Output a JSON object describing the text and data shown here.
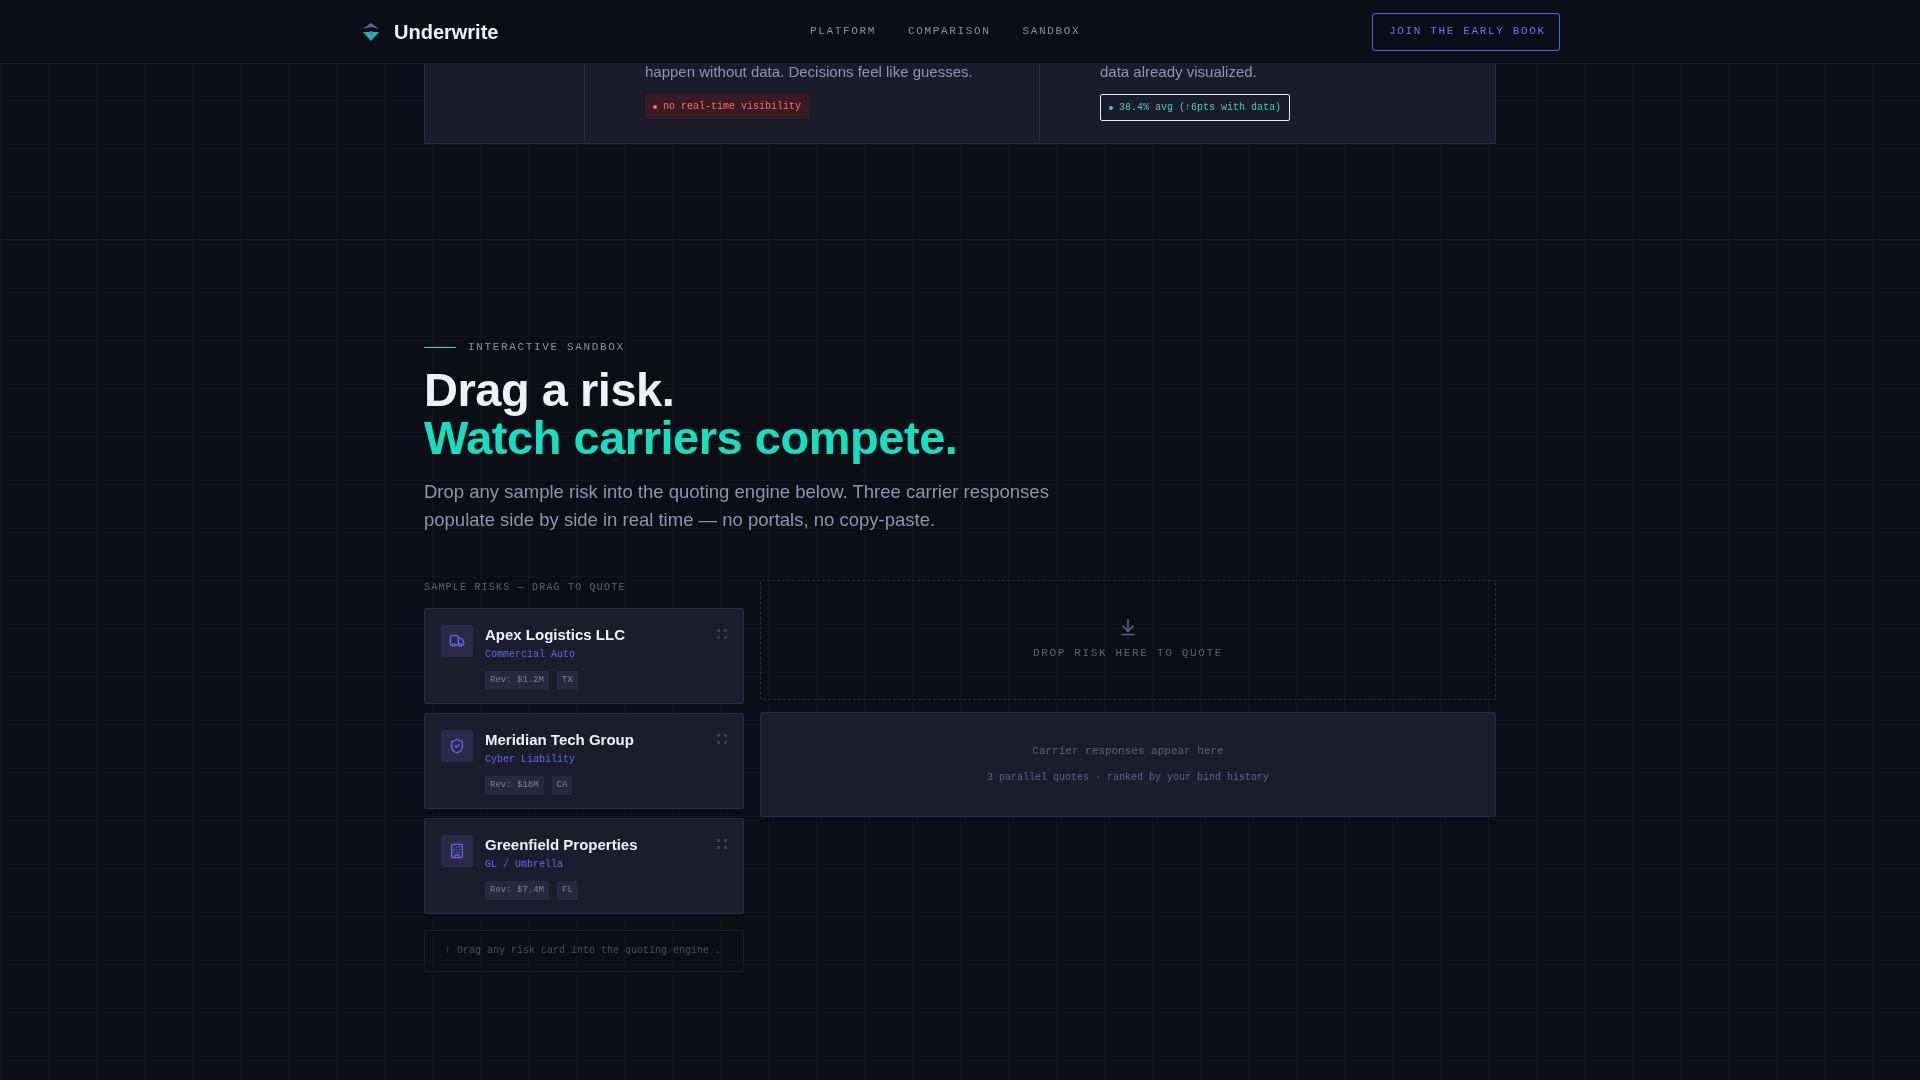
{
  "header": {
    "brand": "Underwrite",
    "nav": [
      {
        "label": "PLATFORM"
      },
      {
        "label": "COMPARISON"
      },
      {
        "label": "SANDBOX"
      }
    ],
    "cta": "JOIN THE EARLY BOOK"
  },
  "comparison": {
    "columns": [
      {
        "text": "happen without data. Decisions feel like guesses.",
        "badge": {
          "kind": "bad",
          "label": "no real-time visibility"
        }
      },
      {
        "text": "data already visualized.",
        "badge": {
          "kind": "good",
          "label": "38.4% avg (↑6pts with data)"
        }
      }
    ]
  },
  "sandbox": {
    "eyebrow": "INTERACTIVE SANDBOX",
    "title_line1": "Drag a risk.",
    "title_line2": "Watch carriers compete.",
    "description": "Drop any sample risk into the quoting engine below. Three carrier responses populate side by side in real time — no portals, no copy-paste.",
    "risks_label": "SAMPLE RISKS — DRAG TO QUOTE",
    "risks": [
      {
        "kind": "truck",
        "name": "Apex Logistics LLC",
        "line": "Commercial Auto",
        "tags": [
          "Rev: $1.2M",
          "TX"
        ]
      },
      {
        "kind": "shield",
        "name": "Meridian Tech Group",
        "line": "Cyber Liability",
        "tags": [
          "Rev: $18M",
          "CA"
        ]
      },
      {
        "kind": "building",
        "name": "Greenfield Properties",
        "line": "GL / Umbrella",
        "tags": [
          "Rev: $7.4M",
          "FL"
        ]
      }
    ],
    "hint": "↑ Drag any risk card into the quoting engine .",
    "drop_zone": "DROP RISK HERE TO QUOTE",
    "results": {
      "title": "Carrier responses appear here",
      "subtitle": "3 parallel quotes · ranked by your bind history"
    }
  }
}
